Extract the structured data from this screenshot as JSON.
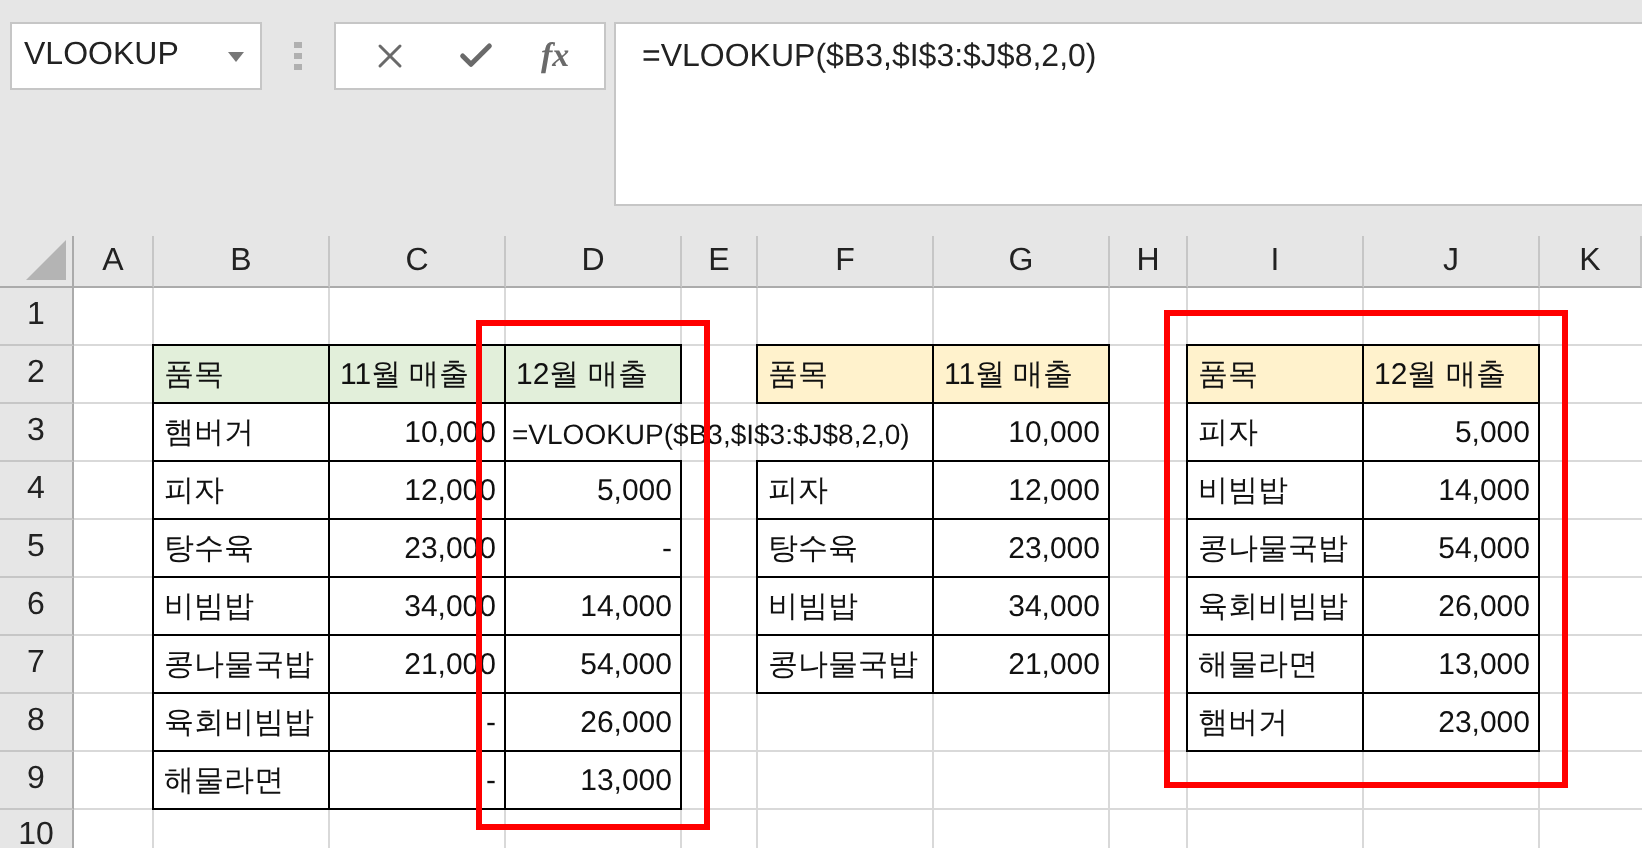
{
  "name_box": {
    "value": "VLOOKUP"
  },
  "function_button": "fx",
  "formula": "=VLOOKUP($B3,$I$3:$J$8,2,0)",
  "columns": [
    "A",
    "B",
    "C",
    "D",
    "E",
    "F",
    "G",
    "H",
    "I",
    "J",
    "K"
  ],
  "rows": [
    "1",
    "2",
    "3",
    "4",
    "5",
    "6",
    "7",
    "8",
    "9",
    "10"
  ],
  "tables": [
    {
      "color": "#e2efda",
      "header": [
        "품목",
        "11월 매출",
        "12월 매출"
      ],
      "rows": [
        [
          "햄버거",
          "10,000",
          {
            "kind": "editing",
            "text": "=VLOOKUP($B3,$I$3:$J$8,2,0)"
          }
        ],
        [
          "피자",
          "12,000",
          "5,000"
        ],
        [
          "탕수육",
          "23,000",
          "-"
        ],
        [
          "비빔밥",
          "34,000",
          "14,000"
        ],
        [
          "콩나물국밥",
          "21,000",
          "54,000"
        ],
        [
          "육회비빔밥",
          "-",
          "26,000"
        ],
        [
          "해물라면",
          "-",
          "13,000"
        ]
      ]
    },
    {
      "color": "#fff2cc",
      "header": [
        "품목",
        "11월 매출"
      ],
      "rows": [
        [
          {
            "kind": "covered"
          },
          "10,000"
        ],
        [
          "피자",
          "12,000"
        ],
        [
          "탕수육",
          "23,000"
        ],
        [
          "비빔밥",
          "34,000"
        ],
        [
          "콩나물국밥",
          "21,000"
        ]
      ]
    },
    {
      "color": "#fff2cc",
      "header": [
        "품목",
        "12월 매출"
      ],
      "rows": [
        [
          "피자",
          "5,000"
        ],
        [
          "비빔밥",
          "14,000"
        ],
        [
          "콩나물국밥",
          "54,000"
        ],
        [
          "육회비빔밥",
          "26,000"
        ],
        [
          "해물라면",
          "13,000"
        ],
        [
          "햄버거",
          "23,000"
        ]
      ]
    }
  ]
}
